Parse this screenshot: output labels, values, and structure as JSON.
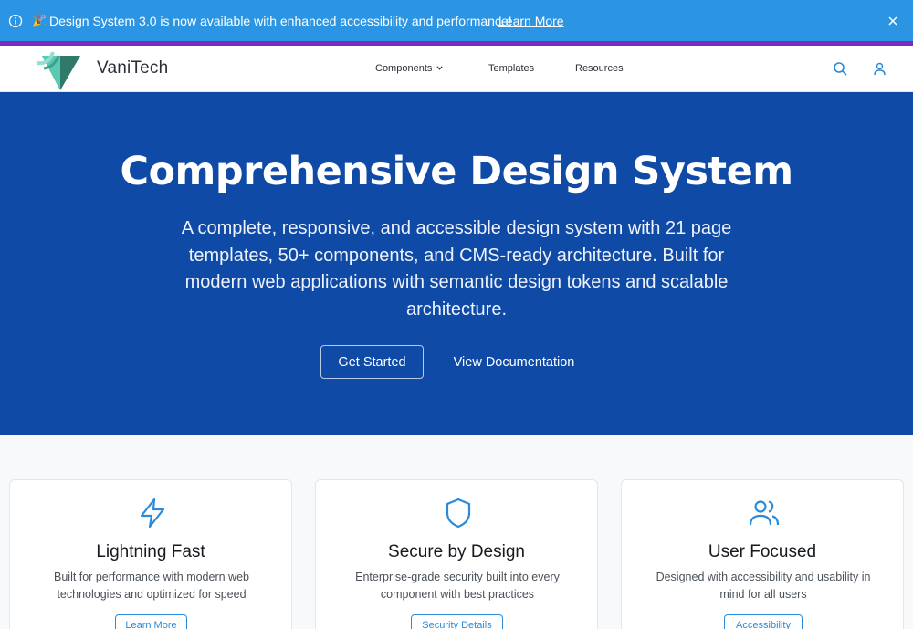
{
  "banner": {
    "icon": "info-icon",
    "emoji": "🎉",
    "message": "Design System 3.0 is now available with enhanced accessibility and performance!",
    "link_label": "Learn More",
    "close_icon": "close-icon",
    "background": "#2b95e4",
    "accent_stripe": "#7b2cbf"
  },
  "header": {
    "brand": "VaniTech",
    "nav": [
      {
        "label": "Components",
        "has_dropdown": true
      },
      {
        "label": "Templates",
        "has_dropdown": false
      },
      {
        "label": "Resources",
        "has_dropdown": false
      }
    ],
    "icons": [
      "search-icon",
      "user-icon"
    ]
  },
  "hero": {
    "title": "Comprehensive Design System",
    "subtitle": "A complete, responsive, and accessible design system with 21 page templates, 50+ components, and CMS-ready architecture. Built for modern web applications with semantic design tokens and scalable architecture.",
    "primary_button": "Get Started",
    "secondary_button": "View Documentation",
    "background": "#0f4aa6"
  },
  "features": [
    {
      "icon": "lightning-icon",
      "title": "Lightning Fast",
      "description": "Built for performance with modern web technologies and optimized for speed",
      "button": "Learn More"
    },
    {
      "icon": "shield-icon",
      "title": "Secure by Design",
      "description": "Enterprise-grade security built into every component with best practices",
      "button": "Security Details"
    },
    {
      "icon": "users-icon",
      "title": "User Focused",
      "description": "Designed with accessibility and usability in mind for all users",
      "button": "Accessibility"
    }
  ],
  "accent_color": "#2b8bd8"
}
